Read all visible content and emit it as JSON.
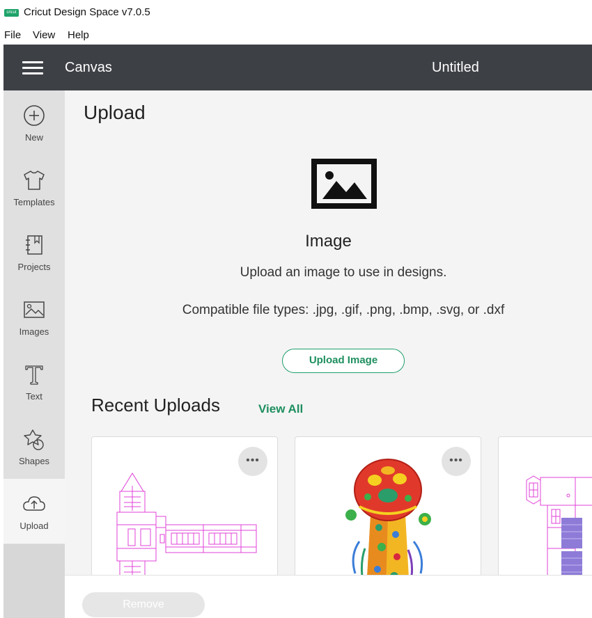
{
  "window": {
    "logo_text": "cricut",
    "title": "Cricut Design Space  v7.0.5"
  },
  "menu": {
    "file": "File",
    "view": "View",
    "help": "Help"
  },
  "topnav": {
    "section": "Canvas",
    "document_title": "Untitled"
  },
  "sidebar": {
    "items": [
      {
        "label": "New",
        "icon": "plus-circle-icon"
      },
      {
        "label": "Templates",
        "icon": "tshirt-icon"
      },
      {
        "label": "Projects",
        "icon": "notebook-icon"
      },
      {
        "label": "Images",
        "icon": "image-icon"
      },
      {
        "label": "Text",
        "icon": "text-t-icon"
      },
      {
        "label": "Shapes",
        "icon": "shapes-icon"
      },
      {
        "label": "Upload",
        "icon": "cloud-upload-icon",
        "active": true
      }
    ]
  },
  "upload": {
    "heading": "Upload",
    "image_heading": "Image",
    "description": "Upload an image to use in designs.",
    "file_types": "Compatible file types: .jpg, .gif, .png, .bmp, .svg, or .dxf",
    "button": "Upload Image",
    "recent_heading": "Recent Uploads",
    "view_all": "View All",
    "more_label": "•••"
  },
  "footer": {
    "remove": "Remove"
  },
  "colors": {
    "nav_bg": "#3d4045",
    "accent": "#1e9e6b",
    "sidebar_bg": "#e0e0e0",
    "main_bg": "#f4f4f4"
  }
}
